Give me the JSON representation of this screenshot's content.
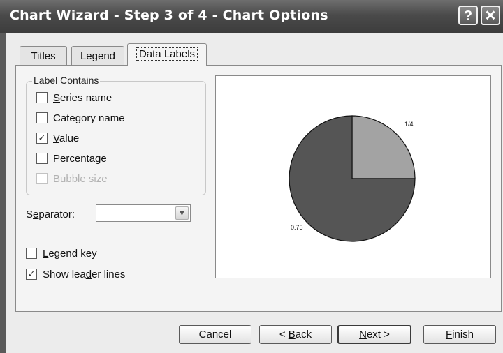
{
  "window": {
    "title": "Chart Wizard - Step 3 of 4 - Chart Options",
    "help_glyph": "?",
    "close_glyph": "✕"
  },
  "tabs": [
    {
      "label": "Titles"
    },
    {
      "label": "Legend"
    },
    {
      "label": "Data Labels",
      "active": true
    }
  ],
  "label_contains": {
    "legend": "Label Contains",
    "options": [
      {
        "pre": "",
        "key": "S",
        "post": "eries name",
        "checked": false,
        "enabled": true
      },
      {
        "pre": "Cate",
        "key": "g",
        "post": "ory name",
        "checked": false,
        "enabled": true
      },
      {
        "pre": "",
        "key": "V",
        "post": "alue",
        "checked": true,
        "enabled": true
      },
      {
        "pre": "",
        "key": "P",
        "post": "ercentage",
        "checked": false,
        "enabled": true
      },
      {
        "pre": "Bubble size",
        "key": "",
        "post": "",
        "checked": false,
        "enabled": false
      }
    ]
  },
  "separator": {
    "pre": "S",
    "key": "e",
    "post": "parator:",
    "value": ""
  },
  "legend_key": {
    "pre": "",
    "key": "L",
    "post": "egend key",
    "checked": false
  },
  "leader_lines": {
    "pre": "Show lea",
    "key": "d",
    "post": "er lines",
    "checked": true
  },
  "check_glyph": "✓",
  "dropdown_glyph": "▼",
  "chart_data": {
    "type": "pie",
    "values": [
      0.25,
      0.75
    ],
    "labels": [
      "1/4",
      "0.75"
    ],
    "colors": [
      "#a3a3a3",
      "#555555"
    ]
  },
  "buttons": {
    "cancel": "Cancel",
    "back_pre": "< ",
    "back_key": "B",
    "back_post": "ack",
    "next_key": "N",
    "next_post": "ext >",
    "finish_key": "F",
    "finish_post": "inish"
  }
}
